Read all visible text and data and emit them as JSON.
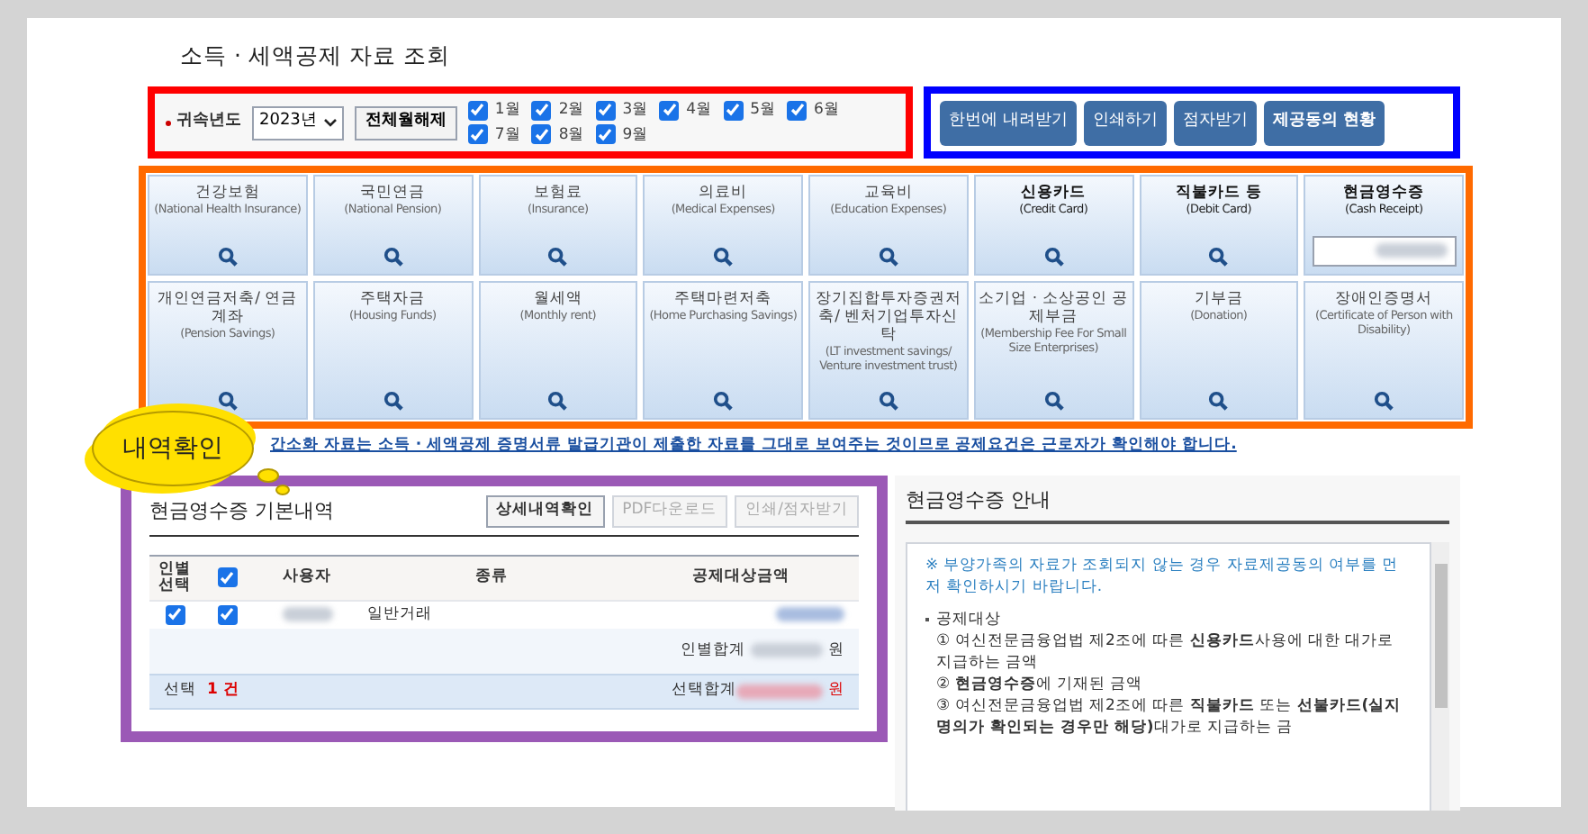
{
  "title": "소득 · 세액공제 자료 조회",
  "filter": {
    "label": "귀속년도",
    "year": "2023년",
    "clear_button": "전체월해제",
    "months": [
      {
        "label": "1월",
        "checked": true
      },
      {
        "label": "2월",
        "checked": true
      },
      {
        "label": "3월",
        "checked": true
      },
      {
        "label": "4월",
        "checked": true
      },
      {
        "label": "5월",
        "checked": true
      },
      {
        "label": "6월",
        "checked": true
      },
      {
        "label": "7월",
        "checked": true
      },
      {
        "label": "8월",
        "checked": true
      },
      {
        "label": "9월",
        "checked": true
      }
    ]
  },
  "actions": [
    "한번에 내려받기",
    "인쇄하기",
    "점자받기",
    "제공동의 현황"
  ],
  "cards": [
    {
      "title": "건강보험",
      "subtitle": "(National Health Insurance)",
      "emphasized": false,
      "kind": "search"
    },
    {
      "title": "국민연금",
      "subtitle": "(National Pension)",
      "emphasized": false,
      "kind": "search"
    },
    {
      "title": "보험료",
      "subtitle": "(Insurance)",
      "emphasized": false,
      "kind": "search"
    },
    {
      "title": "의료비",
      "subtitle": "(Medical Expenses)",
      "emphasized": false,
      "kind": "search"
    },
    {
      "title": "교육비",
      "subtitle": "(Education Expenses)",
      "emphasized": false,
      "kind": "search"
    },
    {
      "title": "신용카드",
      "subtitle": "(Credit Card)",
      "emphasized": true,
      "kind": "search"
    },
    {
      "title": "직불카드 등",
      "subtitle": "(Debit Card)",
      "emphasized": true,
      "kind": "search"
    },
    {
      "title": "현금영수증",
      "subtitle": "(Cash Receipt)",
      "emphasized": true,
      "kind": "field"
    },
    {
      "title": "개인연금저축/ 연금계좌",
      "subtitle": "(Pension Savings)",
      "emphasized": false,
      "kind": "search"
    },
    {
      "title": "주택자금",
      "subtitle": "(Housing Funds)",
      "emphasized": false,
      "kind": "search"
    },
    {
      "title": "월세액",
      "subtitle": "(Monthly rent)",
      "emphasized": false,
      "kind": "search"
    },
    {
      "title": "주택마련저축",
      "subtitle": "(Home Purchasing Savings)",
      "emphasized": false,
      "kind": "search"
    },
    {
      "title": "장기집합투자증권저축/ 벤처기업투자신탁",
      "subtitle": "(LT investment savings/ Venture investment trust)",
      "emphasized": false,
      "kind": "search"
    },
    {
      "title": "소기업 · 소상공인 공제부금",
      "subtitle": "(Membership Fee For Small Size Enterprises)",
      "emphasized": false,
      "kind": "search"
    },
    {
      "title": "기부금",
      "subtitle": "(Donation)",
      "emphasized": false,
      "kind": "search"
    },
    {
      "title": "장애인증명서",
      "subtitle": "(Certificate of Person with Disability)",
      "emphasized": false,
      "kind": "search"
    }
  ],
  "callout": "내역확인",
  "notice": "간소화 자료는 소득 · 세액공제 증명서류 발급기관이 제출한 자료를 그대로 보여주는 것이므로 공제요건은 근로자가 확인해야 합니다.",
  "detail": {
    "title": "현금영수증 기본내역",
    "buttons": [
      {
        "label": "상세내역확인",
        "disabled": false
      },
      {
        "label": "PDF다운로드",
        "disabled": true
      },
      {
        "label": "인쇄/점자받기",
        "disabled": true
      }
    ],
    "columns": [
      "인별 선택",
      "사용자",
      "종류",
      "공제대상금액"
    ],
    "header_checked": true,
    "rows": [
      {
        "person_checked": true,
        "checked": true,
        "type": "일반거래"
      }
    ],
    "subtotal_label": "인별합계",
    "subtotal_unit": "원",
    "selected_label": "선택",
    "selected_count": "1 건",
    "total_label": "선택합계",
    "total_unit": "원"
  },
  "info": {
    "title": "현금영수증 안내",
    "note": "※ 부양가족의 자료가 조회되지 않는 경우 자료제공동의 여부를 먼저 확인하시기 바랍니다.",
    "heading": "공제대상",
    "items": [
      "① 여신전문금융업법 제2조에 따른 **신용카드**사용에 대한 대가로 지급하는 금액",
      "② **현금영수증**에 기재된 금액",
      "③ 여신전문금융업법 제2조에 따른 **직불카드** 또는 **선불카드(실지명의가 확인되는 경우만 해당)**대가로 지급하는 금"
    ]
  }
}
